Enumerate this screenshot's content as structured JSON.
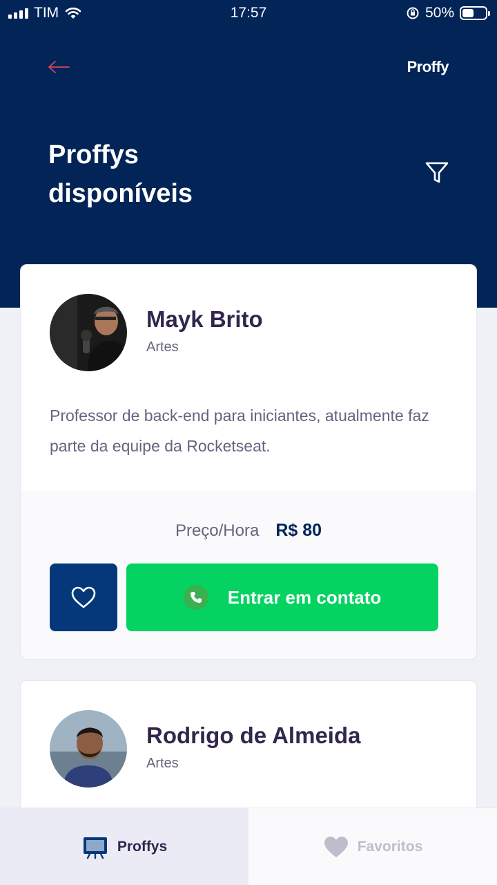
{
  "status_bar": {
    "carrier": "TIM",
    "time": "17:57",
    "battery": "50%",
    "battery_level": 0.5
  },
  "header": {
    "logo": "Proffy",
    "title": "Proffys disponíveis"
  },
  "teachers": [
    {
      "name": "Mayk Brito",
      "subject": "Artes",
      "bio": "Professor de back-end para iniciantes, atualmente faz parte da equipe da Rocketseat.",
      "price_label": "Preço/Hora",
      "price": "R$ 80",
      "contact_label": "Entrar em contato"
    },
    {
      "name": "Rodrigo de Almeida",
      "subject": "Artes"
    }
  ],
  "tabs": [
    {
      "label": "Proffys",
      "icon": "tv-icon",
      "active": true
    },
    {
      "label": "Favoritos",
      "icon": "heart-icon",
      "active": false
    }
  ],
  "colors": {
    "primary": "#022457",
    "green": "#04D361",
    "text_title": "#32264D",
    "text_base": "#6A6180",
    "back_arrow": "#D4465A"
  }
}
